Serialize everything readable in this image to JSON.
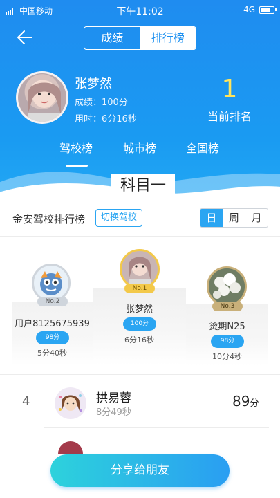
{
  "status_bar": {
    "carrier": "中国移动",
    "time": "下午11:02",
    "network": "4G"
  },
  "header": {
    "segment": [
      {
        "label": "成绩",
        "active": false
      },
      {
        "label": "排行榜",
        "active": true
      }
    ]
  },
  "user": {
    "name": "张梦然",
    "score": "成绩：100分",
    "time": "用时：6分16秒",
    "rank": "1",
    "rank_label": "当前排名"
  },
  "tabs": [
    {
      "label": "驾校榜",
      "active": true
    },
    {
      "label": "城市榜",
      "active": false
    },
    {
      "label": "全国榜",
      "active": false
    }
  ],
  "subject": "科目一",
  "school": {
    "name": "金安驾校排行榜",
    "switch_label": "切换驾校",
    "periods": [
      {
        "label": "日",
        "selected": true
      },
      {
        "label": "周",
        "selected": false
      },
      {
        "label": "月",
        "selected": false
      }
    ]
  },
  "podium": {
    "first": {
      "badge": "No.1",
      "name": "张梦然",
      "score": "100分",
      "time": "6分16秒"
    },
    "second": {
      "badge": "No.2",
      "name": "用户8125675939",
      "score": "98分",
      "time": "5分40秒"
    },
    "third": {
      "badge": "No.3",
      "name": "烫期N25",
      "score": "98分",
      "time": "10分4秒"
    }
  },
  "list": [
    {
      "rank": "4",
      "name": "拱易蓉",
      "time": "8分49秒",
      "score": "89",
      "unit": "分"
    }
  ],
  "share_label": "分享给朋友",
  "colors": {
    "primary_blue": "#1f8cf0",
    "accent_blue": "#2aa5f2",
    "rank_yellow": "#ffe45c",
    "gold": "#f3c94a",
    "silver": "#cfd5dc",
    "bronze": "#c9b07a"
  }
}
